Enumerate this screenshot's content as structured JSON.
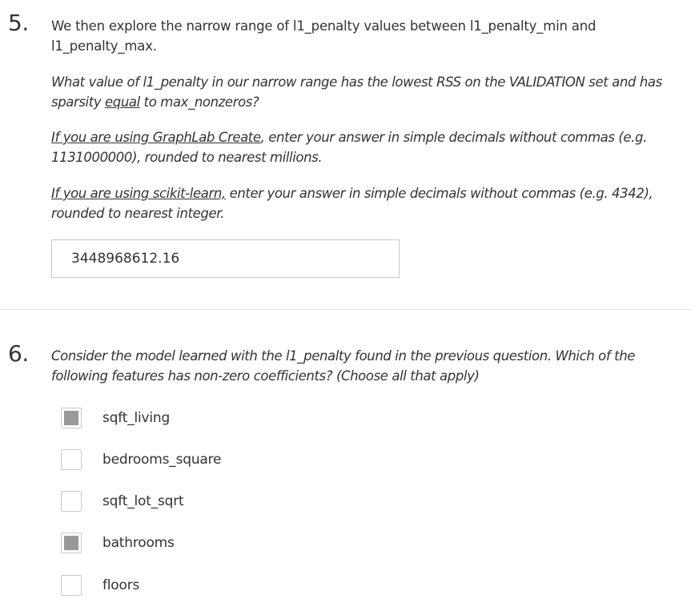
{
  "q5": {
    "number": "5.",
    "prompt_line1": "We then explore the narrow range of l1_penalty values between l1_penalty_min and",
    "prompt_line2": "l1_penalty_max.",
    "question_line1": "What value of l1_penalty in our narrow range has the lowest RSS on the VALIDATION set and has",
    "question_line2_pre": "sparsity ",
    "question_line2_u": "equal",
    "question_line2_post": " to max_nonzeros?",
    "graphlab_u": "If you are using GraphLab Create",
    "graphlab_rest1": ", enter your answer in simple decimals without commas (e.g.",
    "graphlab_line2": "1131000000), rounded to nearest millions.",
    "sklearn_u": "If you are using scikit-learn,",
    "sklearn_rest1": " enter your answer in simple decimals without commas (e.g. 4342),",
    "sklearn_line2": "rounded to nearest integer.",
    "answer_value": "3448968612.16"
  },
  "q6": {
    "number": "6.",
    "question_line1": "Consider the model learned with the l1_penalty found in the previous question. Which of the",
    "question_line2": "following features has non-zero coefficients? (Choose all that apply)",
    "options": [
      {
        "label": "sqft_living",
        "checked": true
      },
      {
        "label": "bedrooms_square",
        "checked": false
      },
      {
        "label": "sqft_lot_sqrt",
        "checked": false
      },
      {
        "label": "bathrooms",
        "checked": true
      },
      {
        "label": "floors",
        "checked": false
      }
    ]
  }
}
